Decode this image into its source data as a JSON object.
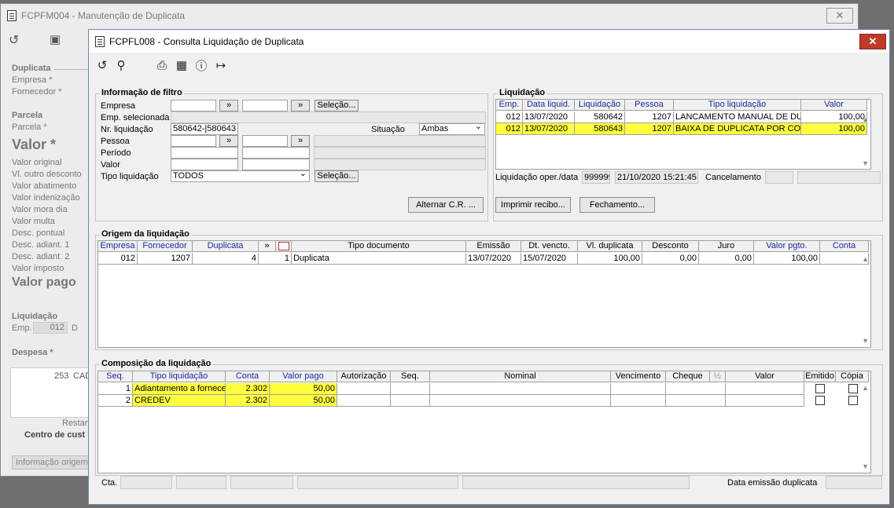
{
  "back_window": {
    "title": "FCPFM004 - Manutenção de Duplicata",
    "labels": {
      "duplicata": "Duplicata",
      "empresa": "Empresa *",
      "fornecedor": "Fornecedor *",
      "parcela_group": "Parcela",
      "parcela": "Parcela *",
      "valor": "Valor *",
      "valor_original": "Valor original",
      "vl_outro_desconto": "Vl. outro desconto",
      "valor_abatimento": "Valor abatimento",
      "valor_indenizacao": "Valor indenização",
      "valor_mora_dia": "Valor mora dia",
      "valor_multa": "Valor multa",
      "desc_pontual": "Desc. pontual",
      "desc_adiant_1": "Desc. adiant. 1",
      "desc_adiant_2": "Desc. adiant. 2",
      "valor_imposto": "Valor imposto",
      "valor_pago": "Valor pago",
      "liquidacao": "Liquidação",
      "emp": "Emp.",
      "emp_value": "012",
      "d": "D",
      "despesa": "Despesa *",
      "despesa_value": "253",
      "despesa_code": "CAD",
      "restan": "Restan",
      "centro_custo": "Centro de cust",
      "info_origem": "Informação origem"
    }
  },
  "window": {
    "title": "FCPFL008 - Consulta Liquidação de Duplicata",
    "close": "✕"
  },
  "filtro": {
    "title": "Informação de filtro",
    "empresa": "Empresa",
    "emp_selecionada": "Emp. selecionada",
    "nr_liquidacao": "Nr. liquidação",
    "nr_liquidacao_value": "580642-|580643",
    "situacao": "Situação",
    "situacao_value": "Ambas",
    "pessoa": "Pessoa",
    "periodo": "Período",
    "valor": "Valor",
    "tipo_liquidacao": "Tipo liquidação",
    "tipo_liquidacao_value": "TODOS",
    "selecao": "Seleção...",
    "chevrons": "»",
    "alternar": "Alternar C.R. ..."
  },
  "liquidacao": {
    "title": "Liquidação",
    "columns": [
      "Emp.",
      "Data liquid.",
      "Liquidação",
      "Pessoa",
      "Tipo liquidação",
      "Valor"
    ],
    "rows": [
      [
        "012",
        "13/07/2020",
        "580642",
        "1207",
        "LANCAMENTO MANUAL DE DUP",
        "100,00"
      ],
      [
        "012",
        "13/07/2020",
        "580643",
        "1207",
        "BAIXA DE DUPLICATA POR CONT",
        "100,00"
      ]
    ],
    "oper_data_label": "Liquidação oper./data",
    "oper_value": "999999",
    "data_value": "21/10/2020 15:21:45",
    "cancelamento": "Cancelamento",
    "imprimir": "Imprimir recibo...",
    "fechamento": "Fechamento..."
  },
  "origem": {
    "title": "Origem da liquidação",
    "columns": [
      "Empresa",
      "Fornecedor",
      "Duplicata",
      "»",
      "",
      "Tipo documento",
      "Emissão",
      "Dt. vencto.",
      "Vl. duplicata",
      "Desconto",
      "Juro",
      "Valor  pgto.",
      "Conta"
    ],
    "rows": [
      [
        "012",
        "1207",
        "4",
        "",
        "1",
        "Duplicata",
        "13/07/2020",
        "15/07/2020",
        "100,00",
        "0,00",
        "0,00",
        "100,00",
        ""
      ]
    ]
  },
  "composicao": {
    "title": "Composição da liquidação",
    "columns": [
      "Seq.",
      "Tipo liquidação",
      "Conta",
      "Valor pago",
      "Autorização",
      "Seq.",
      "Nominal",
      "Vencimento",
      "Cheque",
      "½",
      "Valor",
      "Emitido",
      "Cópia"
    ],
    "rows": [
      [
        "1",
        "Adiantamento a fornece",
        "2.302",
        "50,00"
      ],
      [
        "2",
        "CREDEV",
        "2.302",
        "50,00"
      ]
    ]
  },
  "footer": {
    "cta": "Cta.",
    "data_emissao": "Data emissão duplicata"
  },
  "colors": {
    "highlight": "#ffff40",
    "header_blue": "#1a2aa0",
    "close_red": "#c0392b"
  }
}
